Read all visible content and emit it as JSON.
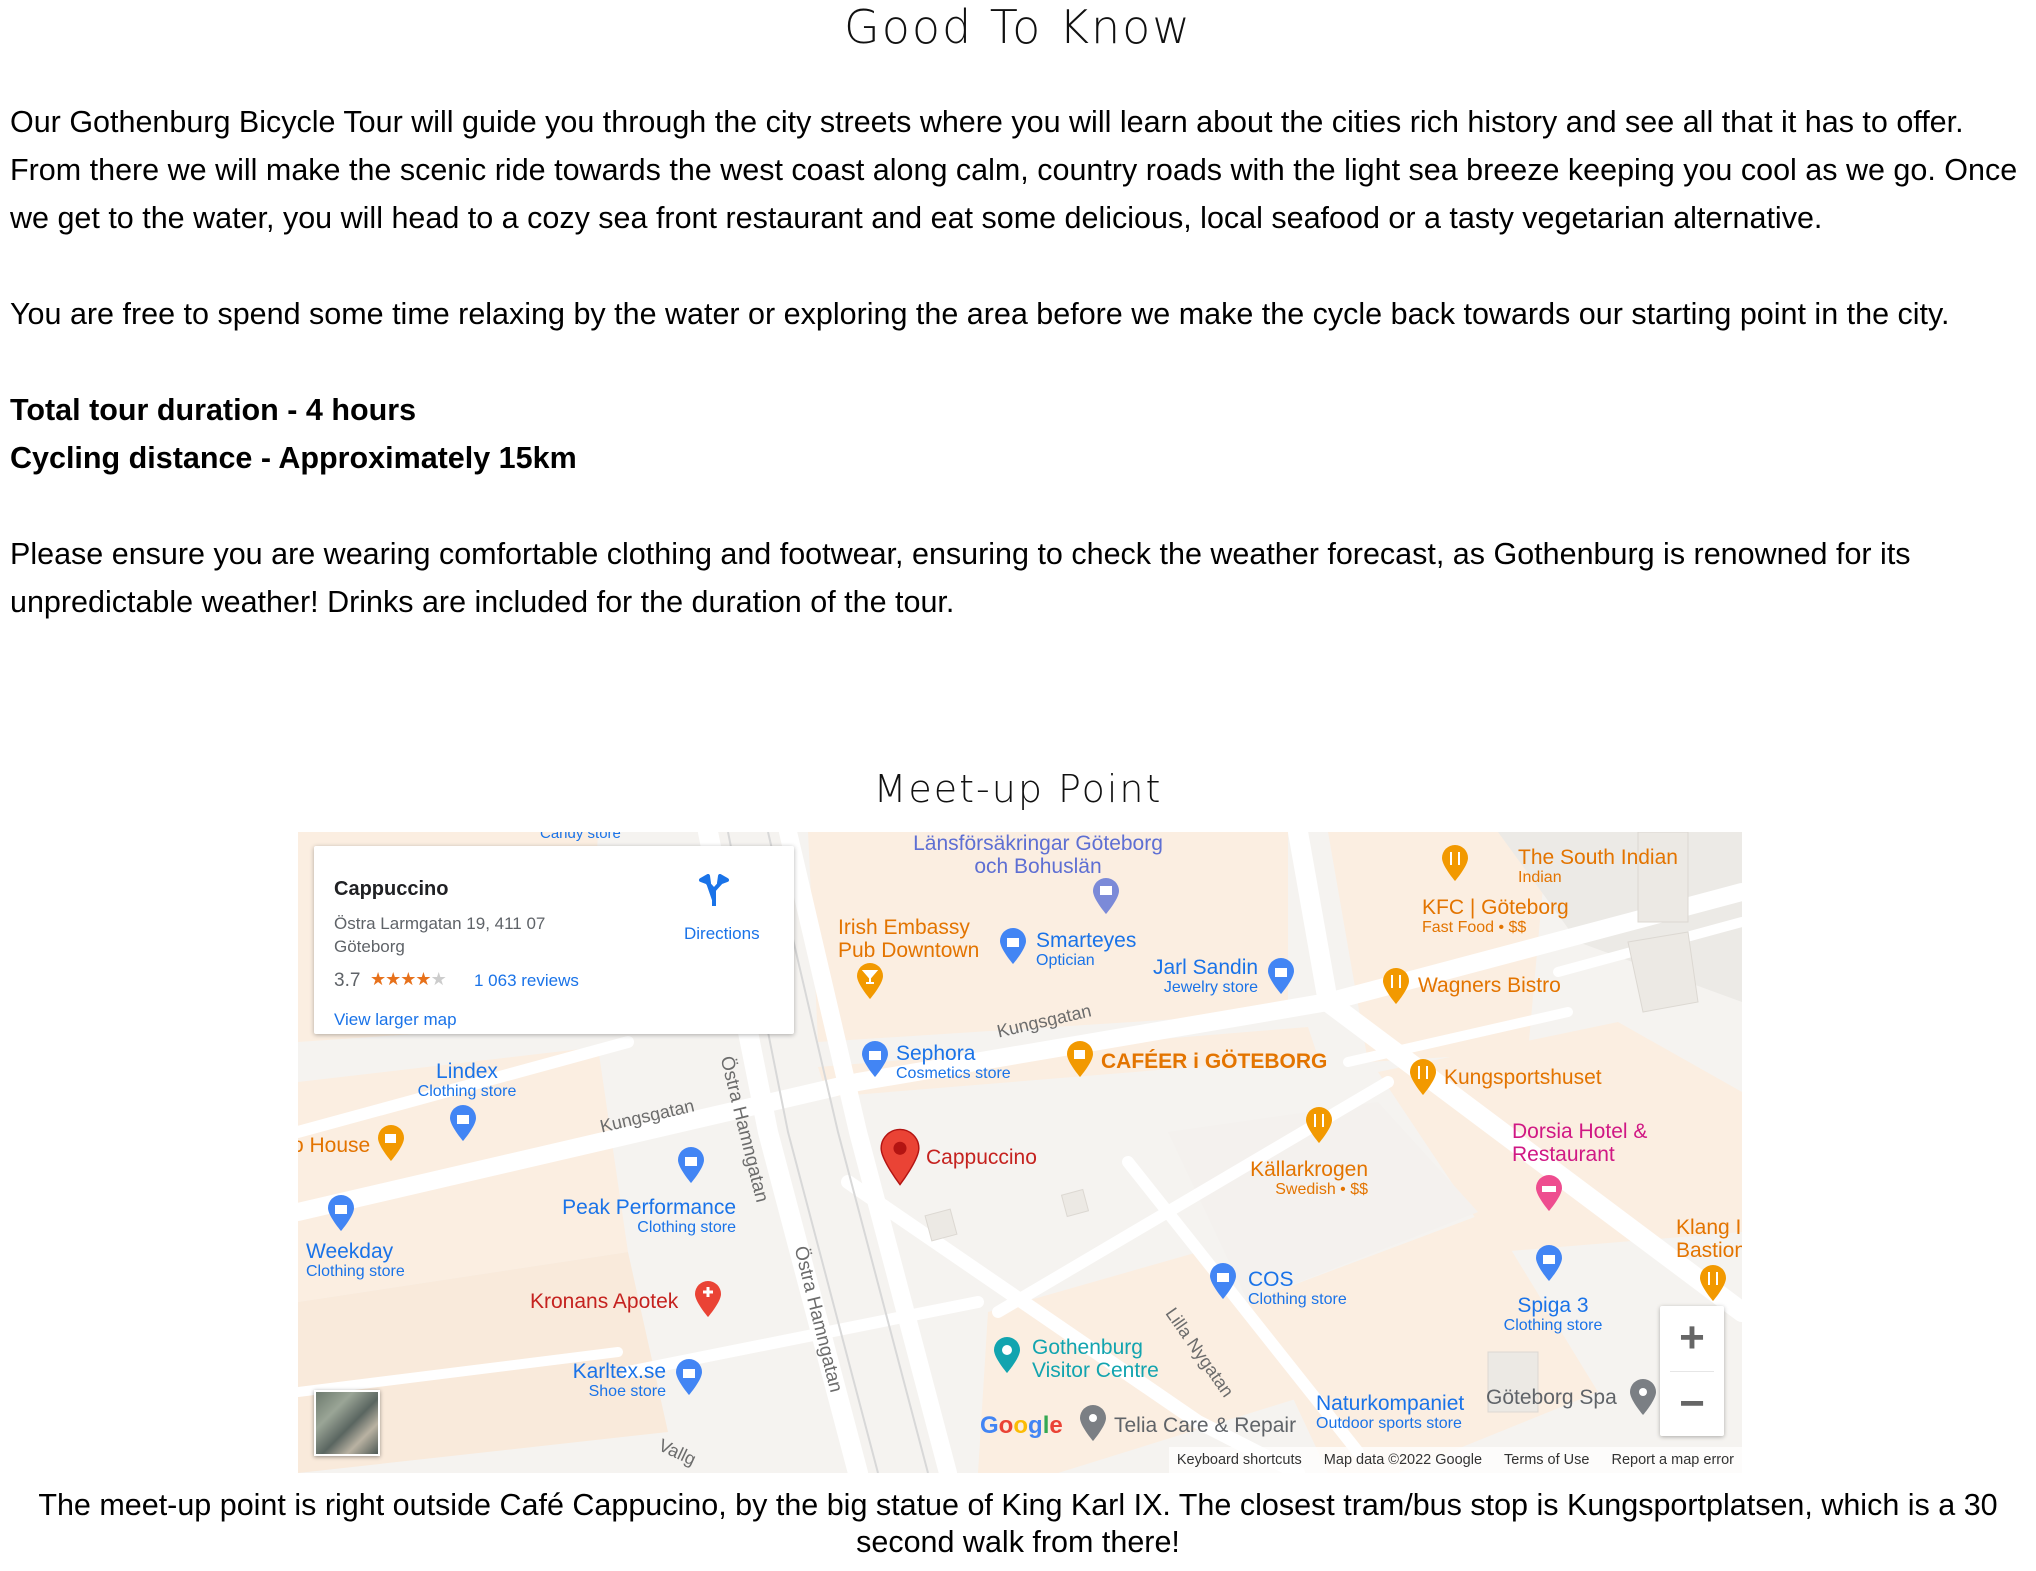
{
  "page": {
    "title": "Good To Know",
    "paragraphs": [
      "Our Gothenburg Bicycle Tour will guide you through the city streets where you will learn about the cities rich history and see all that it has to offer. From there we will make the scenic ride towards the west coast along calm, country roads with the light sea breeze keeping you cool as we go. Once we get to the water, you will head to a cozy sea front restaurant and eat some delicious, local seafood or a tasty vegetarian alternative.",
      "You are free to spend some time relaxing by the water or exploring the area before we make the cycle back towards our starting point in the city."
    ],
    "facts": [
      "Total tour duration - 4 hours",
      "Cycling distance - Approximately 15km"
    ],
    "note": "Please ensure you are wearing comfortable clothing and footwear, ensuring to check the weather forecast, as Gothenburg is renowned for its unpredictable weather! Drinks are included for the duration of the tour.",
    "meetup_title": "Meet-up Point",
    "caption": "The meet-up point is right outside Café Cappucino, by the big statue of King Karl IX. The closest tram/bus stop is Kungsportplatsen, which is a 30 second walk from there!"
  },
  "map": {
    "info_card": {
      "name": "Cappuccino",
      "address": "Östra Larmgatan 19, 411 07 Göteborg",
      "rating": "3.7",
      "stars_filled": 3.5,
      "reviews": "1 063 reviews",
      "larger_map": "View larger map",
      "directions": "Directions"
    },
    "streets": [
      "Kungsgatan",
      "Kungsgatan",
      "Östra Hamngatan",
      "Östra Hamngatan",
      "Lilla Nygatan",
      "Vallg"
    ],
    "places": [
      {
        "name": "Länsförsäkringar Göteborg och Bohuslän",
        "sub": "",
        "color": "#5e6fd3",
        "icon": "building-icon"
      },
      {
        "name": "Irish Embassy Pub Downtown",
        "sub": "",
        "color": "#e37400",
        "icon": "bar-icon"
      },
      {
        "name": "Smarteyes",
        "sub": "Optician",
        "color": "#1a73e8",
        "icon": "shopping-bag-icon"
      },
      {
        "name": "Jarl Sandin",
        "sub": "Jewelry store",
        "color": "#1a73e8",
        "icon": "shopping-bag-icon"
      },
      {
        "name": "The South Indian",
        "sub": "Indian",
        "color": "#e37400",
        "icon": "restaurant-icon"
      },
      {
        "name": "KFC | Göteborg",
        "sub": "Fast Food • $$",
        "color": "#e37400",
        "icon": "restaurant-icon"
      },
      {
        "name": "Wagners Bistro",
        "sub": "",
        "color": "#e37400",
        "icon": "restaurant-icon"
      },
      {
        "name": "Kungsportshuset",
        "sub": "",
        "color": "#e37400",
        "icon": "restaurant-icon"
      },
      {
        "name": "Sephora",
        "sub": "Cosmetics store",
        "color": "#1a73e8",
        "icon": "shopping-bag-icon"
      },
      {
        "name": "CAFÉER i GÖTEBORG",
        "sub": "",
        "color": "#e37400",
        "icon": "cafe-icon"
      },
      {
        "name": "Lindex",
        "sub": "Clothing store",
        "color": "#1a73e8",
        "icon": "shopping-bag-icon"
      },
      {
        "name": "o House",
        "sub": "",
        "color": "#e37400",
        "icon": "cafe-icon"
      },
      {
        "name": "Cappuccino",
        "sub": "",
        "color": "#c5221f",
        "icon": "red-pin-icon"
      },
      {
        "name": "Dorsia Hotel & Restaurant",
        "sub": "",
        "color": "#d01884",
        "icon": "hotel-icon"
      },
      {
        "name": "Källarkrogen",
        "sub": "Swedish • $$",
        "color": "#e37400",
        "icon": "restaurant-icon"
      },
      {
        "name": "Peak Performance",
        "sub": "Clothing store",
        "color": "#1a73e8",
        "icon": "shopping-bag-icon"
      },
      {
        "name": "Weekday",
        "sub": "Clothing store",
        "color": "#1a73e8",
        "icon": "shopping-bag-icon"
      },
      {
        "name": "Kronans Apotek",
        "sub": "",
        "color": "#c5221f",
        "icon": "pharmacy-icon"
      },
      {
        "name": "COS",
        "sub": "Clothing store",
        "color": "#1a73e8",
        "icon": "shopping-bag-icon"
      },
      {
        "name": "Spiga 3",
        "sub": "Clothing store",
        "color": "#1a73e8",
        "icon": "shopping-bag-icon"
      },
      {
        "name": "Klang I Bastion",
        "sub": "",
        "color": "#e37400",
        "icon": "restaurant-icon"
      },
      {
        "name": "Karltex.se",
        "sub": "Shoe store",
        "color": "#1a73e8",
        "icon": "shopping-bag-icon"
      },
      {
        "name": "Gothenburg Visitor Centre",
        "sub": "",
        "color": "#12a4af",
        "icon": "camera-icon"
      },
      {
        "name": "Telia Care & Repair",
        "sub": "",
        "color": "#5f6368",
        "icon": "gray-pin-icon"
      },
      {
        "name": "Naturkompaniet",
        "sub": "Outdoor sports store",
        "color": "#1a73e8",
        "icon": "shopping-bag-icon"
      },
      {
        "name": "Göteborg Spa",
        "sub": "",
        "color": "#5f6368",
        "icon": "gray-pin-icon"
      },
      {
        "name": "Candy store",
        "sub": "",
        "color": "#1a73e8",
        "icon": "shopping-bag-icon"
      }
    ],
    "controls": {
      "zoom_in": "+",
      "zoom_out": "−"
    },
    "google_logo": "Google",
    "attribution": [
      "Keyboard shortcuts",
      "Map data ©2022 Google",
      "Terms of Use",
      "Report a map error"
    ]
  }
}
